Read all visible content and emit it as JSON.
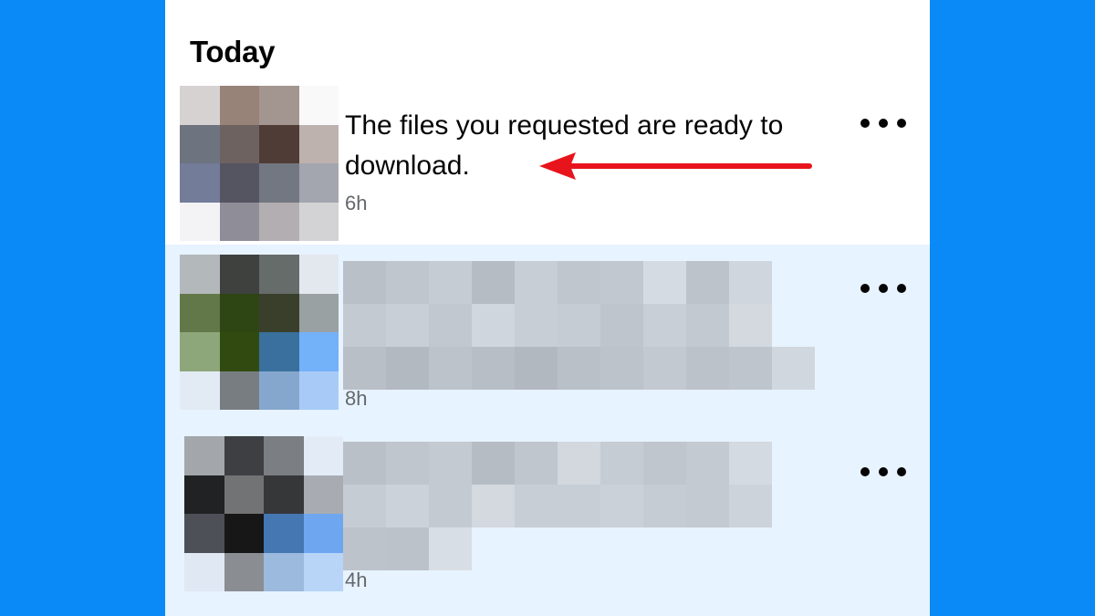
{
  "section": {
    "title": "Today"
  },
  "notifications": [
    {
      "message": "The files you requested are ready to download.",
      "time": "6h",
      "more_icon": "more-horizontal-icon",
      "read": true
    },
    {
      "message": "",
      "time": "8h",
      "more_icon": "more-horizontal-icon",
      "read": false,
      "obscured": true
    },
    {
      "message": "",
      "time": "4h",
      "more_icon": "more-horizontal-icon",
      "read": false,
      "obscured": true
    }
  ],
  "annotation": {
    "icon": "red-arrow-icon",
    "color": "#e8141c"
  },
  "colors": {
    "background": "#0a8af6",
    "panel": "#ffffff",
    "unread_row": "#e7f3ff",
    "secondary_text": "#65676b"
  }
}
